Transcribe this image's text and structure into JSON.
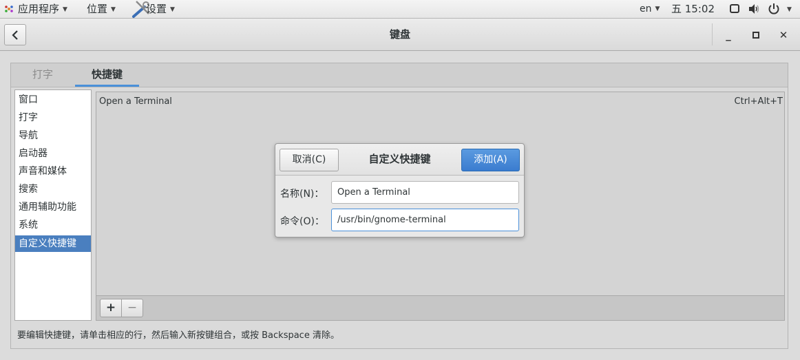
{
  "panel": {
    "apps_label": "应用程序",
    "places_label": "位置",
    "settings_label": "设置",
    "language": "en",
    "clock": "五 15:02"
  },
  "window": {
    "title": "键盘"
  },
  "tabs": [
    {
      "label": "打字",
      "active": false
    },
    {
      "label": "快捷键",
      "active": true
    }
  ],
  "sidebar": {
    "items": [
      {
        "label": "窗口"
      },
      {
        "label": "打字"
      },
      {
        "label": "导航"
      },
      {
        "label": "启动器"
      },
      {
        "label": "声音和媒体"
      },
      {
        "label": "搜索"
      },
      {
        "label": "通用辅助功能"
      },
      {
        "label": "系统"
      },
      {
        "label": "自定义快捷键",
        "selected": true
      }
    ]
  },
  "shortcuts": {
    "rows": [
      {
        "name": "Open a Terminal",
        "accel": "Ctrl+Alt+T"
      }
    ],
    "add_label": "+",
    "remove_label": "−"
  },
  "hint": "要编辑快捷键，请单击相应的行，然后输入新按键组合，或按 Backspace 清除。",
  "dialog": {
    "title": "自定义快捷键",
    "cancel_label": "取消(C)",
    "add_label": "添加(A)",
    "name_label": "名称(N)：",
    "name_value": "Open a Terminal",
    "command_label": "命令(O)：",
    "command_value": "/usr/bin/gnome-terminal"
  },
  "colors": {
    "accent": "#4a90d9",
    "selection": "#4a7fbf",
    "primary_button": "#3a7ccf"
  }
}
